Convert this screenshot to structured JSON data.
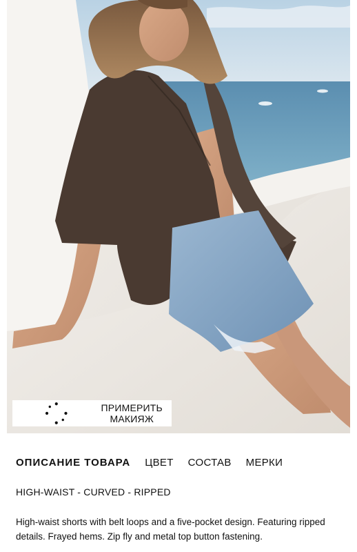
{
  "tryon": {
    "label": "ПРИМЕРИТЬ МАКИЯЖ",
    "icon": "sparkle-icon"
  },
  "tabs": [
    {
      "label": "ОПИСАНИЕ ТОВАРА",
      "active": true
    },
    {
      "label": "ЦВЕТ",
      "active": false
    },
    {
      "label": "СОСТАВ",
      "active": false
    },
    {
      "label": "МЕРКИ",
      "active": false
    }
  ],
  "product": {
    "subtitle": "HIGH-WAIST - CURVED - RIPPED",
    "description": "High-waist shorts with belt loops and a five-pocket design. Featuring ripped details. Frayed hems. Zip fly and metal top button fastening."
  },
  "colors": {
    "shirt": "#4a3a31",
    "denim": "#86a6c4",
    "sea": "#5d8fae",
    "sky": "#c9dbe8"
  }
}
